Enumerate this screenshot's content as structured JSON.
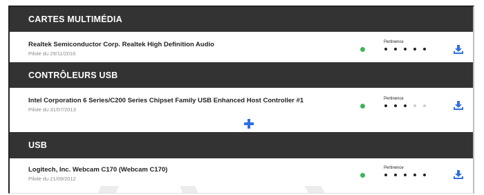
{
  "sections": [
    {
      "title": "CARTES MULTIMÉDIA",
      "devices": [
        {
          "name": "Realtek Semiconductor Corp. Realtek High Definition Audio",
          "driver_date": "Pilote du 29/11/2016",
          "status_color": "#3fb55a",
          "relevance_label": "Pertinence",
          "relevance_score": 5,
          "relevance_max": 5,
          "download_icon": "download-icon"
        }
      ]
    },
    {
      "title": "CONTRÔLEURS USB",
      "devices": [
        {
          "name": "Intel Corporation 6 Series/C200 Series Chipset Family USB Enhanced Host Controller #1",
          "driver_date": "Pilote du 31/07/2013",
          "status_color": "#3fb55a",
          "relevance_label": "Pertinence",
          "relevance_score": 3,
          "relevance_max": 5,
          "download_icon": "download-icon"
        }
      ]
    },
    {
      "title": "USB",
      "devices": [
        {
          "name": "Logitech, Inc. Webcam C170 (Webcam C170)",
          "driver_date": "Pilote du 21/09/2012",
          "status_color": "#3fb55a",
          "relevance_label": "Pertinence",
          "relevance_score": 5,
          "relevance_max": 5,
          "download_icon": "download-icon"
        }
      ]
    }
  ],
  "add_button_icon": "plus-icon",
  "colors": {
    "header_bg": "#333333",
    "accent_blue": "#2f6fe0",
    "dot_filled": "#222222",
    "dot_empty": "#cccccc"
  }
}
